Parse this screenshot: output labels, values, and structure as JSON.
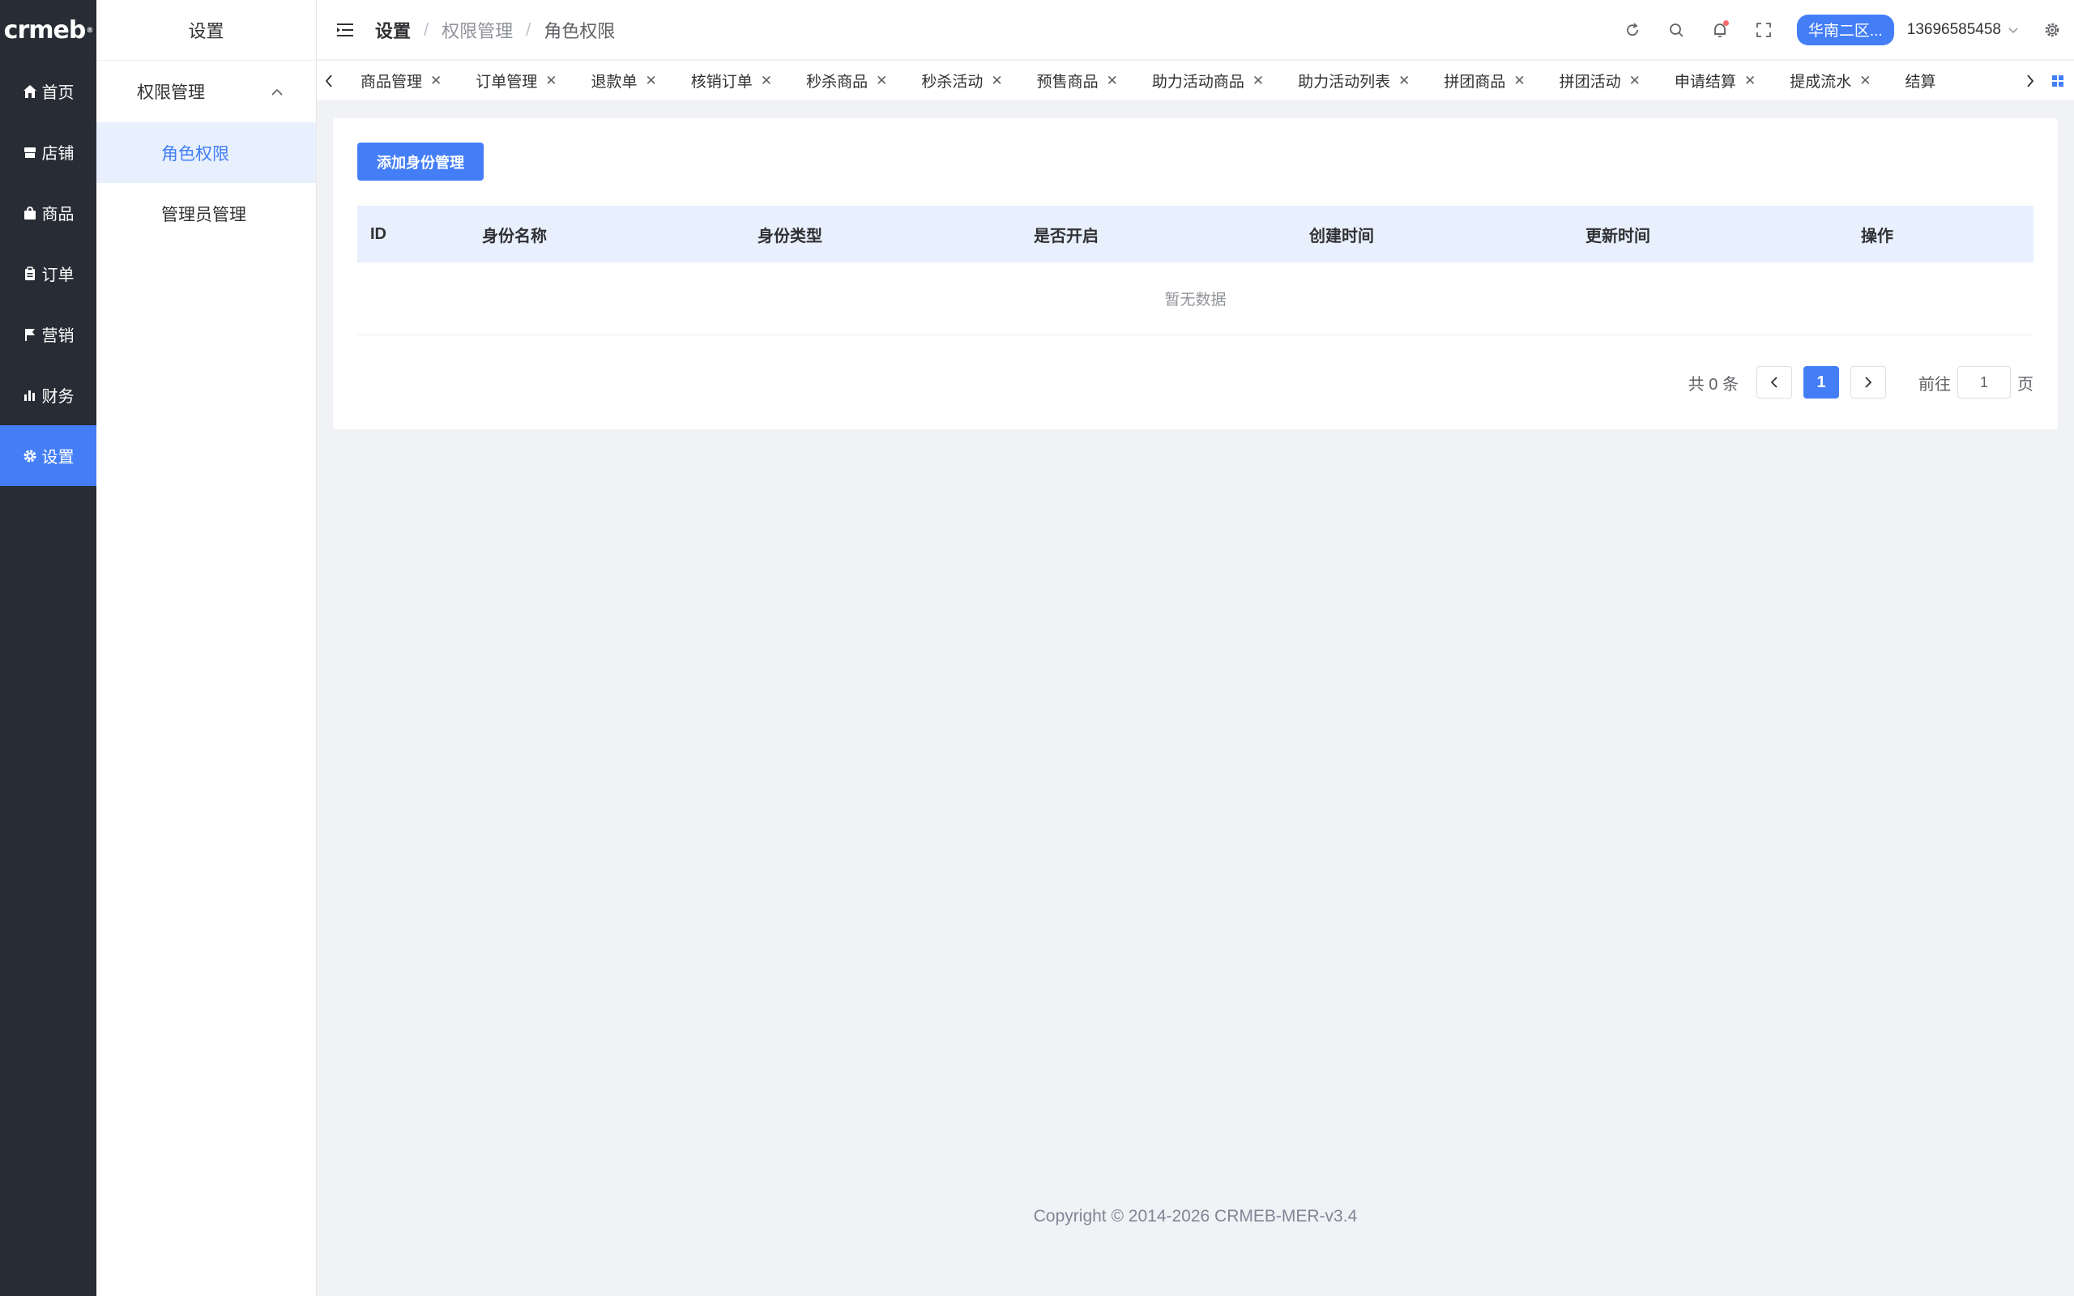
{
  "brand": {
    "logo_text": "crmeb",
    "logo_mark": "®"
  },
  "sidebar": {
    "items": [
      {
        "label": "首页",
        "icon": "home-icon"
      },
      {
        "label": "店铺",
        "icon": "store-icon"
      },
      {
        "label": "商品",
        "icon": "bag-icon"
      },
      {
        "label": "订单",
        "icon": "clipboard-icon"
      },
      {
        "label": "营销",
        "icon": "flag-icon"
      },
      {
        "label": "财务",
        "icon": "bar-chart-icon"
      },
      {
        "label": "设置",
        "icon": "gear-icon",
        "active": true
      }
    ]
  },
  "submenu": {
    "title": "设置",
    "group_label": "权限管理",
    "items": [
      {
        "label": "角色权限",
        "active": true
      },
      {
        "label": "管理员管理"
      }
    ]
  },
  "header": {
    "breadcrumb": [
      "设置",
      "权限管理",
      "角色权限"
    ],
    "region_button": "华南二区...",
    "user_phone": "13696585458"
  },
  "tabs": [
    "商品管理",
    "订单管理",
    "退款单",
    "核销订单",
    "秒杀商品",
    "秒杀活动",
    "预售商品",
    "助力活动商品",
    "助力活动列表",
    "拼团商品",
    "拼团活动",
    "申请结算",
    "提成流水",
    "结算"
  ],
  "main": {
    "add_button": "添加身份管理",
    "table": {
      "columns": [
        "ID",
        "身份名称",
        "身份类型",
        "是否开启",
        "创建时间",
        "更新时间",
        "操作"
      ],
      "rows": [],
      "empty_text": "暂无数据"
    },
    "pagination": {
      "total_text": "共 0 条",
      "current_page": "1",
      "goto_label": "前往",
      "goto_value": "1",
      "page_suffix": "页"
    }
  },
  "footer": {
    "copyright": "Copyright © 2014-2026 CRMEB-MER-v3.4"
  },
  "colors": {
    "primary": "#437ef7",
    "sidebar_bg": "#282c34",
    "page_bg": "#f0f2f5"
  }
}
